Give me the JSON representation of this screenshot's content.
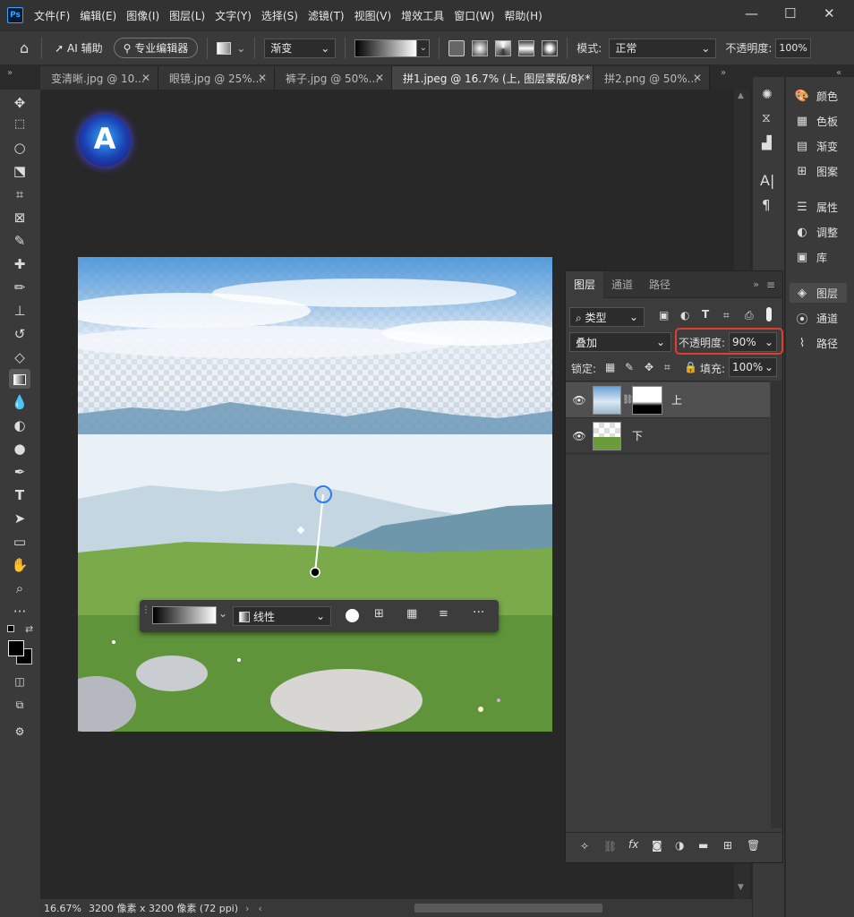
{
  "menubar": {
    "logo": "Ps",
    "items": [
      "文件(F)",
      "编辑(E)",
      "图像(I)",
      "图层(L)",
      "文字(Y)",
      "选择(S)",
      "滤镜(T)",
      "视图(V)",
      "增效工具",
      "窗口(W)",
      "帮助(H)"
    ]
  },
  "options": {
    "ai_assist": "AI 辅助",
    "pro_editor": "专业编辑器",
    "preset": "渐变",
    "mode_label": "模式:",
    "mode_value": "正常",
    "opacity_label": "不透明度:",
    "opacity_value": "100%"
  },
  "tabs": [
    {
      "label": "变清晰.jpg @ 10...",
      "active": false
    },
    {
      "label": "眼镜.jpg @ 25%...",
      "active": false
    },
    {
      "label": "裤子.jpg @ 50%...",
      "active": false
    },
    {
      "label": "拼1.jpeg @ 16.7% (上, 图层蒙版/8) *",
      "active": true
    },
    {
      "label": "拼2.png @ 50%...",
      "active": false
    }
  ],
  "gradient_bar": {
    "type_value": "线性"
  },
  "right_panel_1": {
    "items": [
      {
        "label": "颜色",
        "icon": "palette-icon"
      },
      {
        "label": "色板",
        "icon": "swatches-icon"
      },
      {
        "label": "渐变",
        "icon": "gradient-icon"
      },
      {
        "label": "图案",
        "icon": "pattern-icon"
      },
      {
        "label": "属性",
        "icon": "properties-icon"
      },
      {
        "label": "调整",
        "icon": "adjustments-icon"
      },
      {
        "label": "库",
        "icon": "library-icon"
      }
    ]
  },
  "right_panel_2": {
    "items": [
      {
        "label": "图层",
        "icon": "layers-icon"
      },
      {
        "label": "通道",
        "icon": "channels-icon"
      },
      {
        "label": "路径",
        "icon": "paths-icon"
      }
    ]
  },
  "layers_panel": {
    "tabs": [
      "图层",
      "通道",
      "路径"
    ],
    "filter_label": "类型",
    "blend_mode": "叠加",
    "opacity_label": "不透明度:",
    "opacity_value": "90%",
    "lock_label": "锁定:",
    "fill_label": "填充:",
    "fill_value": "100%",
    "layers": [
      {
        "name": "上",
        "selected": true
      },
      {
        "name": "下",
        "selected": false
      }
    ],
    "highlight_color": "#e0402a"
  },
  "status": {
    "zoom": "16.67%",
    "doc_info": "3200 像素 x 3200 像素 (72 ppi)"
  }
}
